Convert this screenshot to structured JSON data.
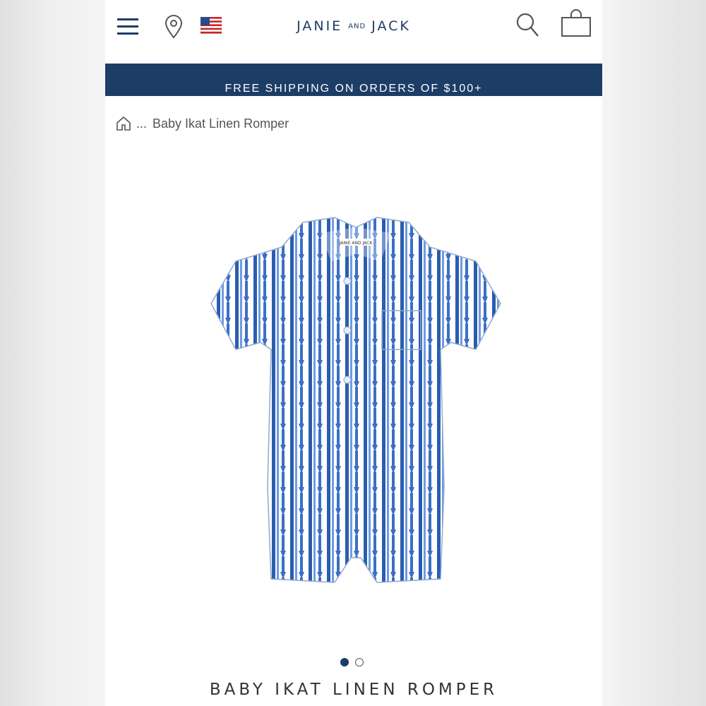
{
  "header": {
    "brand": {
      "left": "JANIE",
      "middle": "AND",
      "right": "JACK"
    },
    "icons": {
      "menu": "hamburger-menu-icon",
      "location": "map-pin-icon",
      "flag": "us-flag-icon",
      "search": "search-icon",
      "bag": "shopping-bag-icon"
    }
  },
  "promo": {
    "text": "FREE SHIPPING ON ORDERS OF $100+"
  },
  "breadcrumb": {
    "ellipsis": "...",
    "current": "Baby Ikat Linen Romper"
  },
  "product": {
    "image": "blue-ikat-romper",
    "title": "BABY IKAT LINEN ROMPER",
    "label_on_garment": "JANIE AND JACK",
    "carousel": {
      "total": 2,
      "active": 1
    }
  },
  "colors": {
    "navy": "#1c3d66",
    "pattern_blue": "#3a6fc4"
  }
}
